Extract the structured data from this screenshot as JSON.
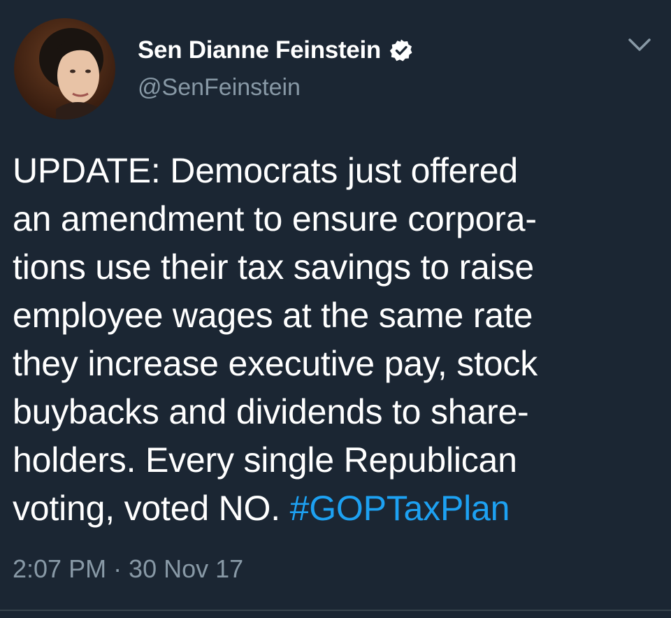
{
  "author": {
    "display_name": "Sen Dianne Feinstein",
    "handle": "@SenFeinstein",
    "verified": true,
    "avatar_icon": "profile-photo"
  },
  "tweet": {
    "lines": [
      "UPDATE: Democrats just offered",
      "an amendment to ensure corpora-",
      "tions use their tax savings to raise",
      "employee wages at the same rate",
      "they increase executive pay, stock",
      "buybacks and dividends to share-",
      "holders. Every single Republican",
      "voting, voted NO. "
    ],
    "hashtag": "#GOPTaxPlan",
    "timestamp": "2:07 PM · 30 Nov 17"
  },
  "icons": {
    "verified": "verified-badge-icon",
    "menu": "chevron-down-icon"
  },
  "colors": {
    "background": "#1b2633",
    "text": "#ffffff",
    "secondary_text": "#8899a6",
    "link": "#1da1f2"
  }
}
